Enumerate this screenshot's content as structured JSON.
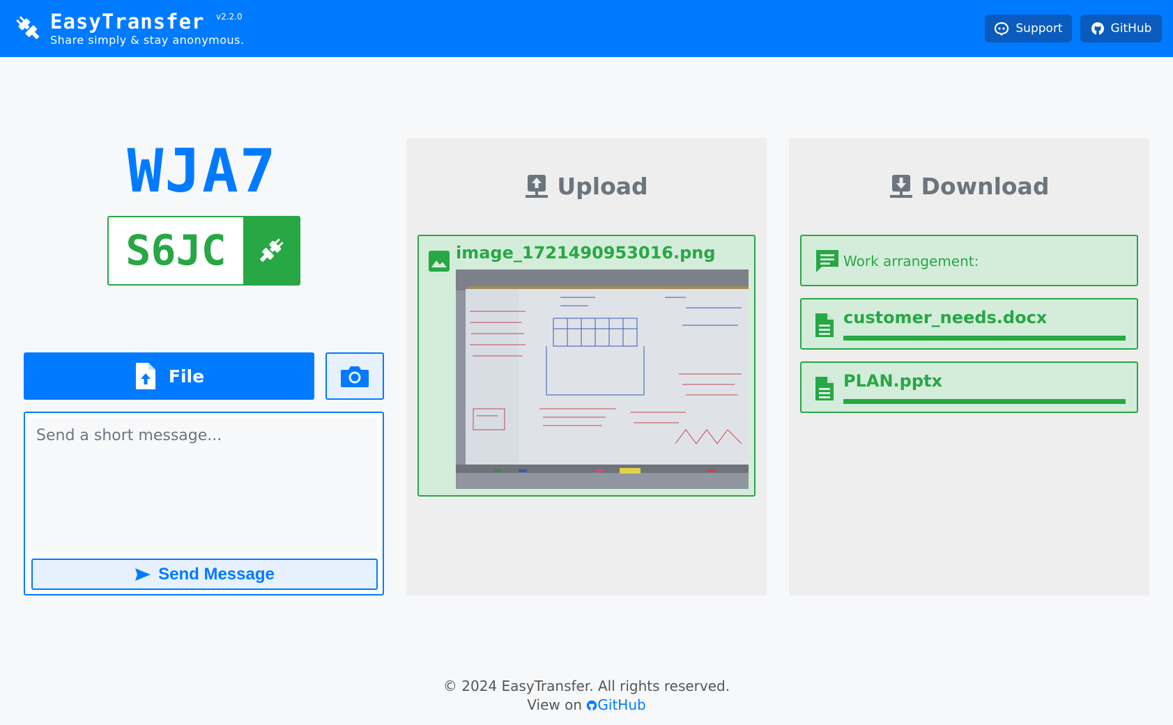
{
  "header": {
    "brand_title": "EasyTransfer",
    "version": "v2.2.0",
    "tagline": "Share simply & stay anonymous.",
    "support_label": "Support",
    "github_label": "GitHub"
  },
  "code": {
    "top": "WJA7",
    "bottom": "S6JC"
  },
  "controls": {
    "file_label": "File",
    "message_placeholder": "Send a short message...",
    "send_label": "Send Message"
  },
  "upload": {
    "title": "Upload",
    "items": [
      {
        "type": "image",
        "name": "image_1721490953016.png"
      }
    ]
  },
  "download": {
    "title": "Download",
    "items": [
      {
        "type": "message",
        "text": "Work arrangement:"
      },
      {
        "type": "file",
        "name": "customer_needs.docx",
        "progress": 1.0
      },
      {
        "type": "file",
        "name": "PLAN.pptx",
        "progress": 1.0
      }
    ]
  },
  "footer": {
    "copyright": "© 2024 EasyTransfer. All rights reserved.",
    "view_on": "View on",
    "github_link": "GitHub"
  },
  "colors": {
    "primary": "#007bff",
    "success": "#28a745",
    "success_bg": "#d4edda",
    "panel_bg": "#eeeeee",
    "muted": "#6c757d"
  },
  "icons": [
    "plug-icon",
    "support-icon",
    "github-icon",
    "file-upload-icon",
    "camera-icon",
    "send-icon",
    "upload-icon",
    "download-icon",
    "image-icon",
    "message-icon",
    "document-icon"
  ]
}
